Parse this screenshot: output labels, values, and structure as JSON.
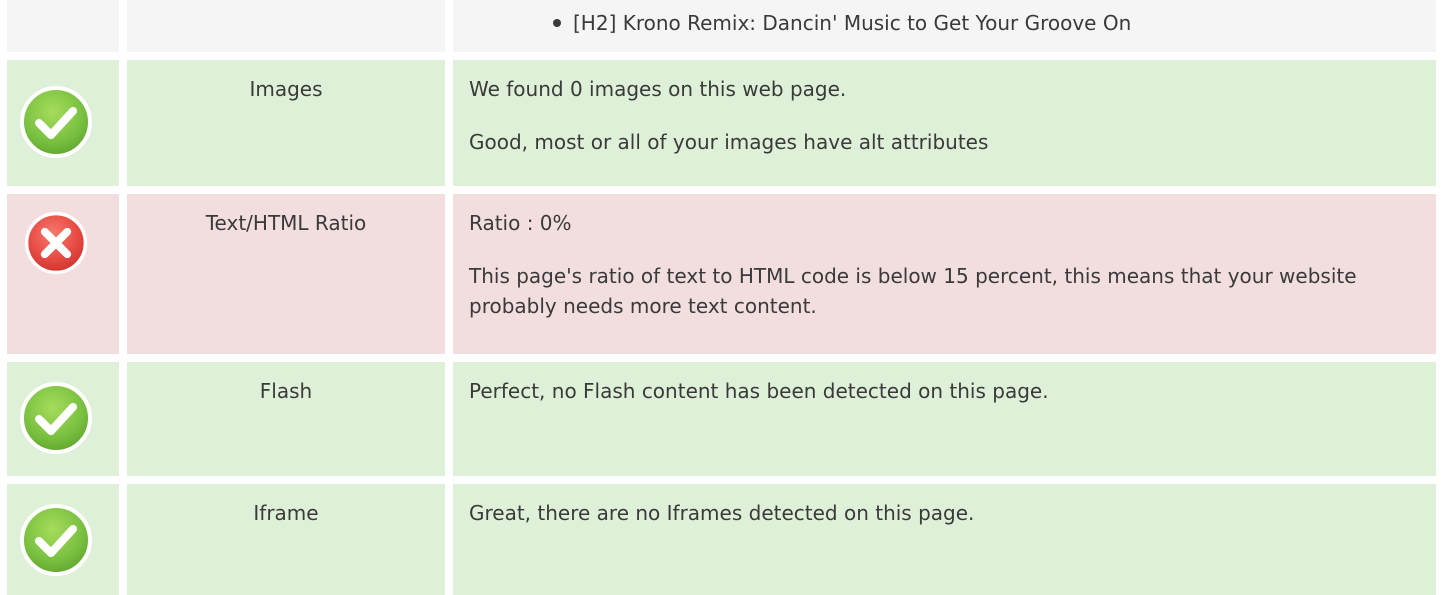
{
  "headings": {
    "items": [
      "[H2] Krono Remix: Dancin' Music to Get Your Groove On"
    ]
  },
  "rows": [
    {
      "status": "pass",
      "status_icon": "check-circle-icon",
      "label": "Images",
      "lines": [
        "We found 0 images on this web page.",
        "Good, most or all of your images have alt attributes"
      ]
    },
    {
      "status": "fail",
      "status_icon": "cross-circle-icon",
      "label": "Text/HTML Ratio",
      "lines": [
        "Ratio : 0%",
        "This page's ratio of text to HTML code is below 15 percent, this means that your website probably needs more text content."
      ]
    },
    {
      "status": "pass",
      "status_icon": "check-circle-icon",
      "label": "Flash",
      "lines": [
        "Perfect, no Flash content has been detected on this page."
      ]
    },
    {
      "status": "pass",
      "status_icon": "check-circle-icon",
      "label": "Iframe",
      "lines": [
        "Great, there are no Iframes detected on this page."
      ]
    }
  ],
  "colors": {
    "pass_bg": "#dff0d8",
    "fail_bg": "#f2dede",
    "neutral_bg": "#f5f5f5",
    "pass_icon": "#7cc242",
    "fail_icon": "#e84a43"
  }
}
